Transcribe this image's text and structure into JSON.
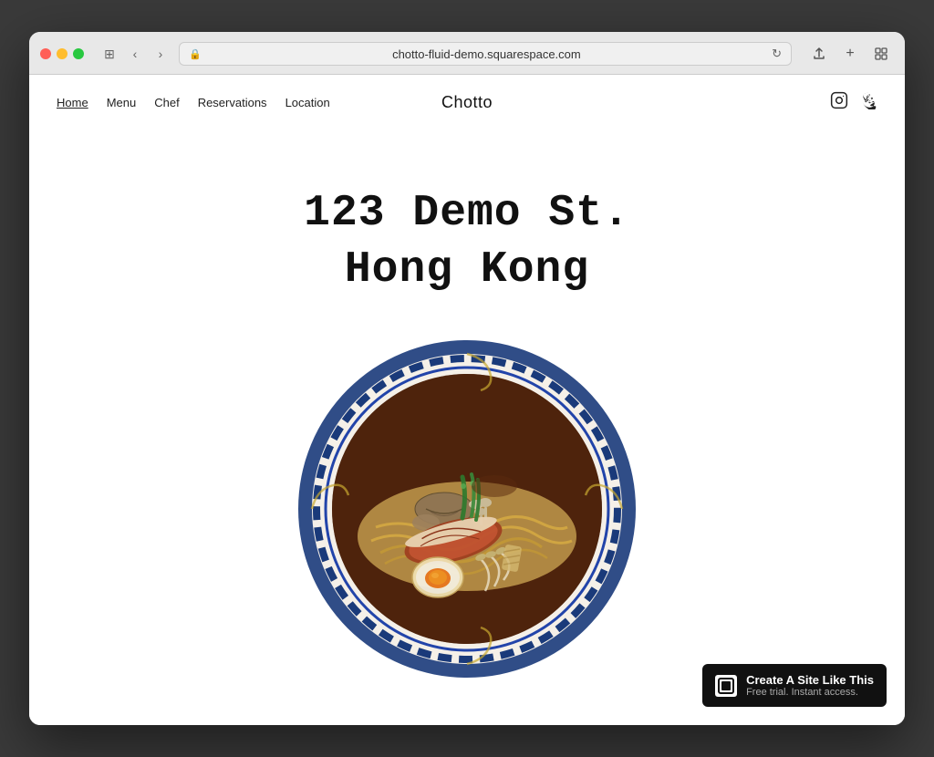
{
  "browser": {
    "url": "chotto-fluid-demo.squarespace.com",
    "back_btn": "‹",
    "forward_btn": "›",
    "refresh_btn": "↻",
    "share_btn": "⬆",
    "new_tab_btn": "+",
    "tab_btn": "⧉"
  },
  "nav": {
    "links": [
      {
        "label": "Home",
        "active": true
      },
      {
        "label": "Menu",
        "active": false
      },
      {
        "label": "Chef",
        "active": false
      },
      {
        "label": "Reservations",
        "active": false
      },
      {
        "label": "Location",
        "active": false
      }
    ],
    "title": "Chotto",
    "social": {
      "instagram": "instagram-icon",
      "yelp": "yelp-icon"
    }
  },
  "hero": {
    "line1": "123 Demo St.",
    "line2": "Hong Kong"
  },
  "squarespace_banner": {
    "main_text": "Create A Site Like This",
    "sub_text": "Free trial. Instant access."
  }
}
